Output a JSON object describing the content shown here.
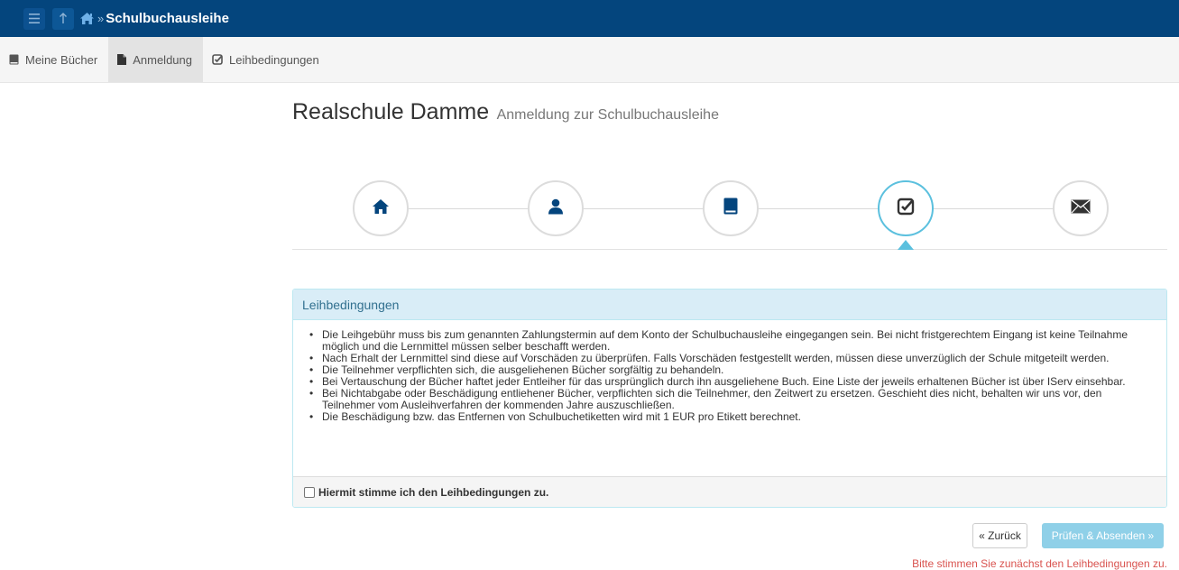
{
  "header": {
    "menu_icon": "hamburger-icon",
    "up_icon": "arrow-up-icon",
    "home_icon": "home-icon",
    "breadcrumb_separator": "»",
    "title": "Schulbuchausleihe"
  },
  "tabs": [
    {
      "label": "Meine Bücher",
      "icon": "book-icon",
      "active": false
    },
    {
      "label": "Anmeldung",
      "icon": "file-icon",
      "active": true
    },
    {
      "label": "Leihbedingungen",
      "icon": "check-square-icon",
      "active": false
    }
  ],
  "page": {
    "school": "Realschule Damme",
    "subtitle": "Anmeldung zur Schulbuchausleihe"
  },
  "wizard": {
    "steps": [
      {
        "icon": "home-icon",
        "active": false
      },
      {
        "icon": "user-icon",
        "active": false
      },
      {
        "icon": "book-icon",
        "active": false
      },
      {
        "icon": "check-square-icon",
        "active": true
      },
      {
        "icon": "envelope-icon",
        "active": false
      }
    ],
    "active_color": "#5bc0de"
  },
  "panel": {
    "title": "Leihbedingungen",
    "items": [
      "Die Leihgebühr muss bis zum genannten Zahlungstermin auf dem Konto der Schulbuchausleihe eingegangen sein. Bei nicht fristgerechtem Eingang ist keine Teilnahme möglich und die Lernmittel müssen selber beschafft werden.",
      "Nach Erhalt der Lernmittel sind diese auf Vorschäden zu überprüfen. Falls Vorschäden festgestellt werden, müssen diese unverzüglich der Schule mitgeteilt werden.",
      "Die Teilnehmer verpflichten sich, die ausgeliehenen Bücher sorgfältig zu behandeln.",
      "Bei Vertauschung der Bücher haftet jeder Entleiher für das ursprünglich durch ihn ausgeliehene Buch. Eine Liste der jeweils erhaltenen Bücher ist über IServ einsehbar.",
      "Bei Nichtabgabe oder Beschädigung entliehener Bücher, verpflichten sich die Teilnehmer, den Zeitwert zu ersetzen. Geschieht dies nicht, behalten wir uns vor, den Teilnehmer vom Ausleihverfahren der kommenden Jahre auszuschließen.",
      "Die Beschädigung bzw. das Entfernen von Schulbuchetiketten wird mit 1 EUR pro Etikett berechnet."
    ],
    "checkbox_label": "Hiermit stimme ich den Leihbedingungen zu.",
    "checkbox_checked": false
  },
  "actions": {
    "back_label": "« Zurück",
    "submit_label": "Prüfen & Absenden »",
    "hint": "Bitte stimmen Sie zunächst den Leihbedingungen zu."
  },
  "colors": {
    "topbar": "#04457d",
    "panel_head": "#d9edf7",
    "hint": "#d9534f"
  }
}
